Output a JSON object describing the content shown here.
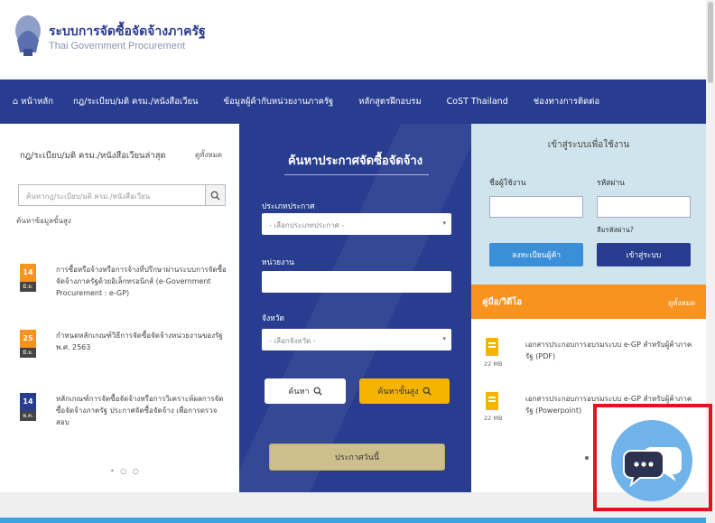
{
  "header": {
    "logo_th": "ระบบการจัดซื้อจัดจ้างภาครัฐ",
    "logo_en": "Thai Government Procurement"
  },
  "nav": {
    "items": [
      "หน้าหลัก",
      "กฎ/ระเบียบ/มติ ครม./หนังสือเวียน",
      "ข้อมูลผู้ค้ากับหน่วยงานภาครัฐ",
      "หลักสูตรฝึกอบรม",
      "CoST Thailand",
      "ช่องทางการติดต่อ"
    ]
  },
  "left": {
    "title": "กฎ/ระเบียบ/มติ ครม./หนังสือเวียนล่าสุด",
    "more": "ดูทั้งหมด",
    "search_placeholder": "ค้นหากฎ/ระเบียบ/มติ ครม./หนังสือเวียน",
    "sub": "ค้นหาข้อมูลขั้นสูง",
    "news": [
      {
        "day": "14",
        "month": "มิ.ย.",
        "text": "การซื้อหรือจ้างหรือการจ้างที่ปรึกษาผ่านระบบการจัดซื้อจัดจ้างภาครัฐด้วยอิเล็กทรอนิกส์ (e-Government Procurement : e-GP)"
      },
      {
        "day": "25",
        "month": "มิ.ย.",
        "text": "กำหนดหลักเกณฑ์วิธีการจัดซื้อจัดจ้างหน่วยงานของรัฐ พ.ศ. 2563"
      },
      {
        "day": "14",
        "month": "พ.ค.",
        "text": "หลักเกณฑ์การจัดซื้อจัดจ้างหรือการวิเคราะห์ผลการจัดซื้อจัดจ้างภาครัฐ ประกาศจัดซื้อจัดจ้าง เพื่อการตรวจสอบ"
      }
    ],
    "pager": "• ○ ○"
  },
  "search_panel": {
    "title": "ค้นหาประกาศจัดซื้อจัดจ้าง",
    "type_label": "ประเภทประกาศ",
    "type_value": "- เลือกประเภทประกาศ -",
    "agency_label": "หน่วยงาน",
    "province_label": "จังหวัด",
    "province_value": "- เลือกจังหวัด -",
    "search_btn": "ค้นหา",
    "adv_search_btn": "ค้นหาขั้นสูง",
    "announce_btn": "ประกาศวันนี้"
  },
  "login": {
    "title": "เข้าสู่ระบบเพื่อใช้งาน",
    "user_label": "ชื่อผู้ใช้งาน",
    "pass_label": "รหัสผ่าน",
    "forgot": "ลืมรหัสผ่าน?",
    "register_btn": "ลงทะเบียนผู้ค้า",
    "login_btn": "เข้าสู่ระบบ"
  },
  "manuals": {
    "title": "คู่มือ/วิดีโอ",
    "more": "ดูทั้งหมด",
    "items": [
      {
        "text": "เอกสารประกอบการอบรมระบบ e-GP สำหรับผู้ค้าภาครัฐ (PDF)",
        "size": "22 MB"
      },
      {
        "text": "เอกสารประกอบการอบรมระบบ e-GP สำหรับผู้ค้าภาครัฐ (Powerpoint)",
        "size": "22 MB"
      }
    ]
  },
  "colors": {
    "nav_blue": "#283d8f",
    "accent_orange": "#f7931e",
    "accent_yellow": "#f4b400",
    "chat_blue": "#6fb3ea",
    "highlight_red": "#e0141e"
  },
  "icons": {
    "search": "magnifier-icon",
    "chat": "chat-bubbles-icon",
    "document": "document-icon"
  }
}
